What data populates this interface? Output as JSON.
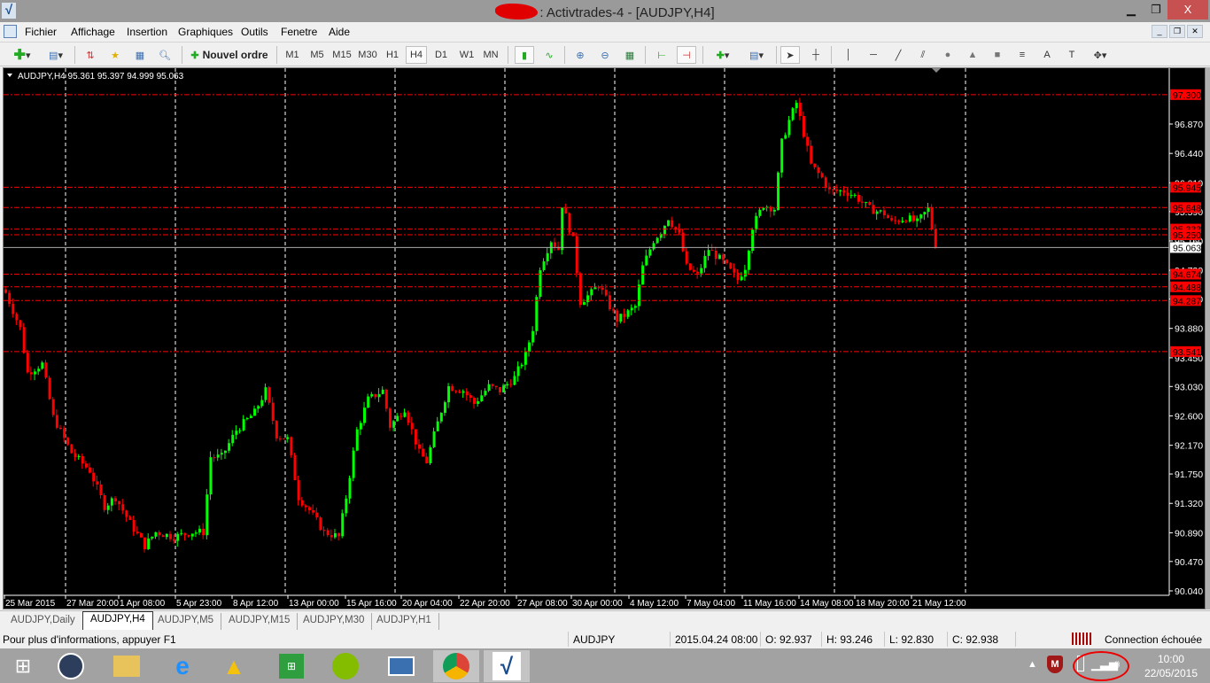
{
  "window": {
    "title": "Activtrades-4 - [AUDJPY,H4]",
    "title_prefix_redacted": ":",
    "controls": [
      "minimize",
      "restore",
      "close"
    ]
  },
  "menu": [
    "Fichier",
    "Affichage",
    "Insertion",
    "Graphiques",
    "Outils",
    "Fenetre",
    "Aide"
  ],
  "toolbar": {
    "new_order": "Nouvel ordre",
    "timeframes": [
      "M1",
      "M5",
      "M15",
      "M30",
      "H1",
      "H4",
      "D1",
      "W1",
      "MN"
    ],
    "selected_timeframe": "H4"
  },
  "chart_info": {
    "symbol": "AUDJPY,H4",
    "ohlc": "95.361 95.397 94.999 95.063"
  },
  "colors": {
    "bull": "#00ff00",
    "bear": "#ff0000",
    "background": "#000000",
    "axis_text": "#ffffff",
    "level_line": "#ff0000"
  },
  "chart_data": {
    "type": "candlestick",
    "symbol": "AUDJPY",
    "timeframe": "H4",
    "ylim": [
      90.04,
      97.3
    ],
    "grid": "vertical dashed",
    "y_ticks": [
      "90.040",
      "90.470",
      "90.890",
      "91.320",
      "91.750",
      "92.170",
      "92.600",
      "93.030",
      "93.450",
      "93.880",
      "94.310",
      "94.730",
      "95.160",
      "95.590",
      "96.010",
      "96.440",
      "96.870"
    ],
    "x_ticks": [
      "25 Mar 2015",
      "27 Mar 20:00",
      "1 Apr 08:00",
      "5 Apr 23:00",
      "8 Apr 12:00",
      "13 Apr 00:00",
      "15 Apr 16:00",
      "20 Apr 04:00",
      "22 Apr 20:00",
      "27 Apr 08:00",
      "30 Apr 00:00",
      "4 May 12:00",
      "7 May 04:00",
      "11 May 16:00",
      "14 May 08:00",
      "18 May 20:00",
      "21 May 12:00"
    ],
    "current_price": "95.063",
    "levels": [
      "97.300",
      "95.945",
      "95.648",
      "95.333",
      "95.250",
      "94.674",
      "94.488",
      "94.287",
      "93.541"
    ],
    "close_path": [
      [
        1,
        94.27
      ],
      [
        4,
        93.88
      ],
      [
        6,
        93.23
      ],
      [
        10,
        93.36
      ],
      [
        13,
        92.58
      ],
      [
        18,
        92.06
      ],
      [
        23,
        91.8
      ],
      [
        27,
        91.28
      ],
      [
        30,
        91.41
      ],
      [
        34,
        91.03
      ],
      [
        38,
        90.7
      ],
      [
        41,
        90.9
      ],
      [
        46,
        90.83
      ],
      [
        51,
        90.9
      ],
      [
        54,
        90.9
      ],
      [
        56,
        92.0
      ],
      [
        59,
        92.0
      ],
      [
        63,
        92.39
      ],
      [
        68,
        92.65
      ],
      [
        71,
        92.97
      ],
      [
        74,
        92.32
      ],
      [
        77,
        92.26
      ],
      [
        80,
        91.41
      ],
      [
        83,
        91.22
      ],
      [
        87,
        90.9
      ],
      [
        91,
        90.83
      ],
      [
        93,
        91.41
      ],
      [
        96,
        92.39
      ],
      [
        99,
        92.84
      ],
      [
        103,
        92.97
      ],
      [
        105,
        92.45
      ],
      [
        109,
        92.71
      ],
      [
        113,
        92.06
      ],
      [
        115,
        91.93
      ],
      [
        117,
        92.32
      ],
      [
        121,
        93.03
      ],
      [
        125,
        92.97
      ],
      [
        128,
        92.78
      ],
      [
        132,
        93.03
      ],
      [
        135,
        92.97
      ],
      [
        139,
        93.16
      ],
      [
        142,
        93.49
      ],
      [
        144,
        93.88
      ],
      [
        146,
        94.78
      ],
      [
        149,
        95.17
      ],
      [
        151,
        95.04
      ],
      [
        152,
        95.69
      ],
      [
        155,
        95.17
      ],
      [
        157,
        94.27
      ],
      [
        160,
        94.4
      ],
      [
        162,
        94.52
      ],
      [
        165,
        94.2
      ],
      [
        167,
        94.01
      ],
      [
        169,
        94.07
      ],
      [
        172,
        94.2
      ],
      [
        174,
        94.78
      ],
      [
        177,
        95.17
      ],
      [
        179,
        95.3
      ],
      [
        181,
        95.5
      ],
      [
        184,
        95.24
      ],
      [
        186,
        94.78
      ],
      [
        189,
        94.65
      ],
      [
        192,
        95.04
      ],
      [
        196,
        94.85
      ],
      [
        200,
        94.59
      ],
      [
        202,
        94.78
      ],
      [
        204,
        95.37
      ],
      [
        207,
        95.69
      ],
      [
        210,
        95.63
      ],
      [
        212,
        96.6
      ],
      [
        214,
        96.92
      ],
      [
        216,
        97.18
      ],
      [
        218,
        96.73
      ],
      [
        220,
        96.27
      ],
      [
        223,
        96.08
      ],
      [
        225,
        95.89
      ],
      [
        229,
        95.89
      ],
      [
        232,
        95.82
      ],
      [
        236,
        95.63
      ],
      [
        240,
        95.56
      ],
      [
        242,
        95.43
      ],
      [
        246,
        95.5
      ],
      [
        249,
        95.43
      ],
      [
        252,
        95.63
      ],
      [
        254,
        95.063
      ]
    ]
  },
  "tabs": [
    "AUDJPY,Daily",
    "AUDJPY,H4",
    "AUDJPY,M5",
    "AUDJPY,M15",
    "AUDJPY,M30",
    "AUDJPY,H1"
  ],
  "active_tab": "AUDJPY,H4",
  "status": {
    "help": "Pour plus d'informations, appuyer F1",
    "symbol": "AUDJPY",
    "datetime": "2015.04.24 08:00",
    "open": "O: 92.937",
    "high": "H: 93.246",
    "low": "L: 92.830",
    "close": "C: 92.938",
    "connection": "Connection échouée"
  },
  "taskbar": {
    "apps": [
      "start",
      "apps",
      "file-explorer",
      "internet-explorer",
      "google-drive",
      "store",
      "spotify",
      "remote-desktop",
      "chrome",
      "metatrader"
    ],
    "time": "10:00",
    "date": "22/05/2015"
  }
}
